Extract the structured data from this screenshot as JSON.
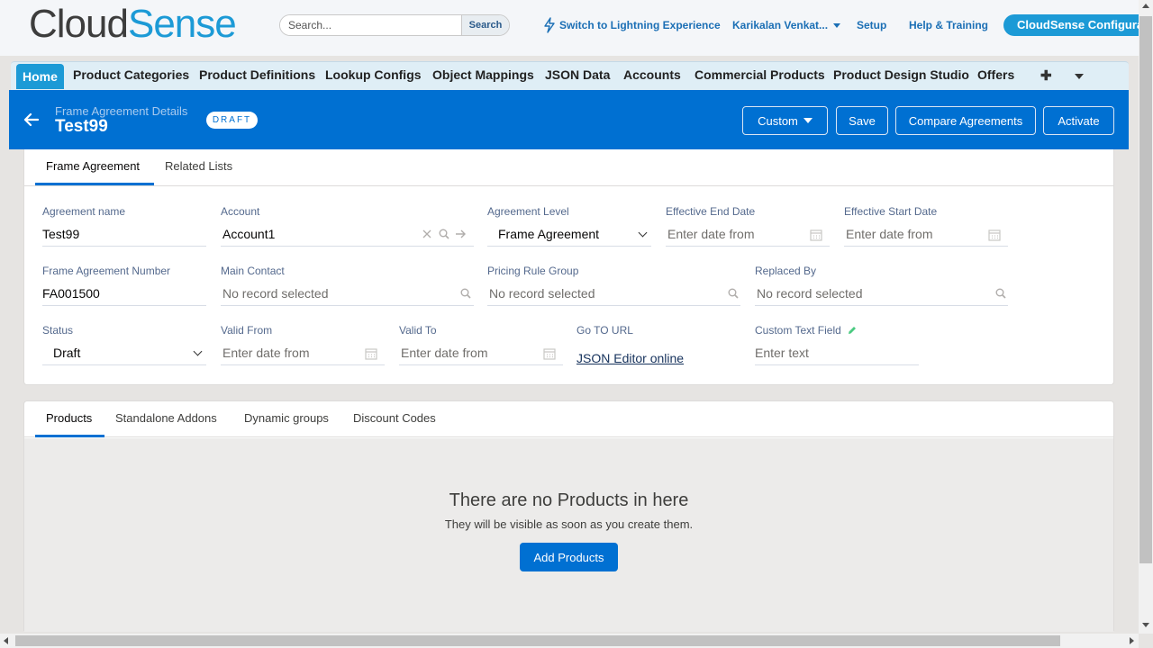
{
  "app": {
    "logo_part1": "Cloud",
    "logo_part2": "Sense",
    "search_placeholder": "Search...",
    "search_button": "Search",
    "lightning_link": "Switch to Lightning Experience",
    "user_menu": "Karikalan Venkat...",
    "setup": "Setup",
    "help": "Help & Training",
    "app_switcher": "CloudSense Configurator"
  },
  "nav": {
    "tabs": [
      "Home",
      "Product Categories",
      "Product Definitions",
      "Lookup Configs",
      "Object Mappings",
      "JSON Data",
      "Accounts",
      "Commercial Products",
      "Product Design Studio",
      "Offers"
    ],
    "active": "Home"
  },
  "record": {
    "subtitle": "Frame Agreement Details",
    "title": "Test99",
    "badge": "DRAFT",
    "buttons": {
      "custom": "Custom",
      "save": "Save",
      "compare": "Compare Agreements",
      "activate": "Activate"
    }
  },
  "detail_tabs": [
    "Frame Agreement",
    "Related Lists"
  ],
  "fields": {
    "agreement_name": {
      "label": "Agreement name",
      "value": "Test99"
    },
    "account": {
      "label": "Account",
      "value": "Account1"
    },
    "agreement_level": {
      "label": "Agreement Level",
      "value": "Frame Agreement"
    },
    "effective_end_date": {
      "label": "Effective End Date",
      "placeholder": "Enter date from"
    },
    "effective_start_date": {
      "label": "Effective Start Date",
      "placeholder": "Enter date from"
    },
    "frame_agreement_number": {
      "label": "Frame Agreement Number",
      "value": "FA001500"
    },
    "main_contact": {
      "label": "Main Contact",
      "placeholder": "No record selected"
    },
    "pricing_rule_group": {
      "label": "Pricing Rule Group",
      "placeholder": "No record selected"
    },
    "replaced_by": {
      "label": "Replaced By",
      "placeholder": "No record selected"
    },
    "status": {
      "label": "Status",
      "value": "Draft"
    },
    "valid_from": {
      "label": "Valid From",
      "placeholder": "Enter date from"
    },
    "valid_to": {
      "label": "Valid To",
      "placeholder": "Enter date from"
    },
    "go_to_url": {
      "label": "Go TO URL",
      "link": "JSON Editor online"
    },
    "custom_text": {
      "label": "Custom Text Field",
      "placeholder": "Enter text"
    }
  },
  "product_tabs": [
    "Products",
    "Standalone Addons",
    "Dynamic groups",
    "Discount Codes"
  ],
  "empty": {
    "title": "There are no Products in here",
    "subtitle": "They will be visible as soon as you create them.",
    "button": "Add Products"
  },
  "colors": {
    "brand_blue": "#0070d2",
    "cloudsense_blue": "#1c9ad6",
    "nav_bg": "#dfeef6"
  }
}
